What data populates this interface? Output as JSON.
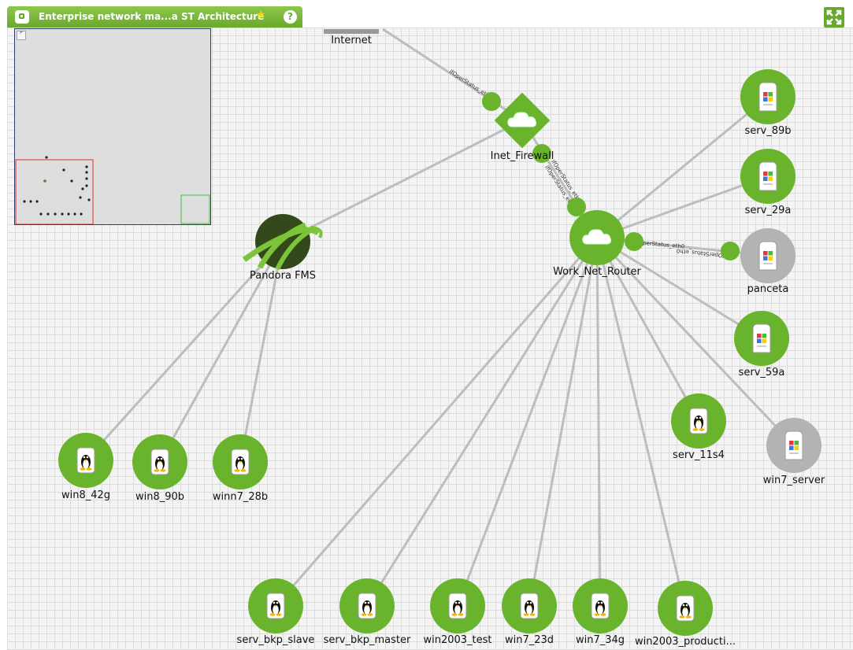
{
  "window": {
    "title": "Enterprise network ma...a ST Architecture",
    "star_glyph": "★",
    "help_glyph": "?",
    "minimap_toggle_glyph": "⌜"
  },
  "colors": {
    "accent": "#6aa82d",
    "node_ok": "#6ab42d",
    "node_unknown": "#b3b3b3",
    "link": "#bdbdbd",
    "pandora_node": "#33491b"
  },
  "nodes": {
    "internet": {
      "label": "Internet",
      "icon": "internet-bar-icon"
    },
    "inet_firewall": {
      "label": "Inet_Firewall",
      "icon": "cloud-icon"
    },
    "work_net_router": {
      "label": "Work_Net_Router",
      "icon": "cloud-icon"
    },
    "pandora_fms": {
      "label": "Pandora FMS",
      "icon": "pandora-logo-icon"
    },
    "serv_89b": {
      "label": "serv_89b",
      "icon": "windows-server-icon"
    },
    "serv_29a": {
      "label": "serv_29a",
      "icon": "windows-server-icon"
    },
    "panceta": {
      "label": "panceta",
      "icon": "windows-server-icon"
    },
    "serv_59a": {
      "label": "serv_59a",
      "icon": "windows-server-icon"
    },
    "serv_11s4": {
      "label": "serv_11s4",
      "icon": "linux-tux-icon"
    },
    "win7_server": {
      "label": "win7_server",
      "icon": "windows-server-icon"
    },
    "win8_42g": {
      "label": "win8_42g",
      "icon": "linux-tux-icon"
    },
    "win8_90b": {
      "label": "win8_90b",
      "icon": "linux-tux-icon"
    },
    "winn7_28b": {
      "label": "winn7_28b",
      "icon": "linux-tux-icon"
    },
    "serv_bkp_slave": {
      "label": "serv_bkp_slave",
      "icon": "linux-tux-icon"
    },
    "serv_bkp_master": {
      "label": "serv_bkp_master",
      "icon": "linux-tux-icon"
    },
    "win2003_test": {
      "label": "win2003_test",
      "icon": "linux-tux-icon"
    },
    "win7_23d": {
      "label": "win7_23d",
      "icon": "linux-tux-icon"
    },
    "win7_34g": {
      "label": "win7_34g",
      "icon": "linux-tux-icon"
    },
    "win2003_producti": {
      "label": "win2003_producti...",
      "icon": "linux-tux-icon"
    }
  },
  "edge_labels": {
    "internet_firewall": "ifOperStatus_eth0",
    "firewall_router_a": "ifOperStatus_eth0",
    "firewall_router_b": "ifOperStatus_eth0",
    "router_panceta_a": "ifOperStatus_eth0",
    "router_panceta_b": "ifOperStatus_eth0"
  }
}
